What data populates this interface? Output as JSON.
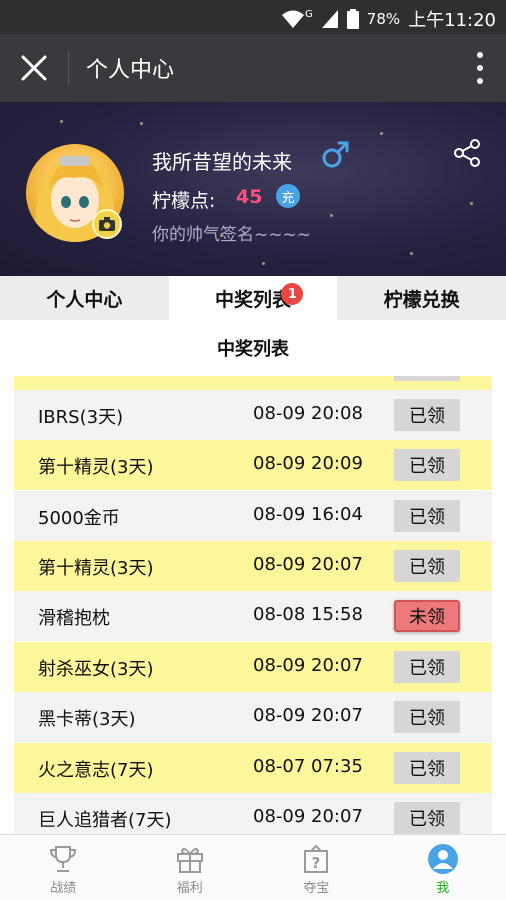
{
  "status_bar": {
    "battery": "78%",
    "time": "上午11:20",
    "network": "G"
  },
  "app_bar": {
    "title": "个人中心"
  },
  "profile": {
    "username": "我所昔望的未来",
    "points_label": "柠檬点:",
    "points_value": "45",
    "charge_label": "充",
    "signature": "你的帅气签名~~~~"
  },
  "tabs": [
    {
      "label": "个人中心"
    },
    {
      "label": "中奖列表",
      "badge": "1"
    },
    {
      "label": "柠檬兑换"
    }
  ],
  "list": {
    "title": "中奖列表",
    "rows": [
      {
        "name": "IBRS(3天)",
        "date": "08-09 20:08",
        "status": "已领"
      },
      {
        "name": "第十精灵(3天)",
        "date": "08-09 20:09",
        "status": "已领"
      },
      {
        "name": "5000金币",
        "date": "08-09 16:04",
        "status": "已领"
      },
      {
        "name": "第十精灵(3天)",
        "date": "08-09 20:07",
        "status": "已领"
      },
      {
        "name": "滑稽抱枕",
        "date": "08-08 15:58",
        "status": "未领"
      },
      {
        "name": "射杀巫女(3天)",
        "date": "08-09 20:07",
        "status": "已领"
      },
      {
        "name": "黑卡蒂(3天)",
        "date": "08-09 20:07",
        "status": "已领"
      },
      {
        "name": "火之意志(7天)",
        "date": "08-07 07:35",
        "status": "已领"
      },
      {
        "name": "巨人追猎者(7天)",
        "date": "08-09 20:07",
        "status": "已领"
      }
    ]
  },
  "bottom_nav": [
    {
      "label": "战绩",
      "icon": "trophy-icon"
    },
    {
      "label": "福利",
      "icon": "gift-icon"
    },
    {
      "label": "夺宝",
      "icon": "mystery-box-icon"
    },
    {
      "label": "我",
      "icon": "user-icon"
    }
  ],
  "colors": {
    "row_yellow": "#fef69a",
    "row_gray": "#f3f3f3",
    "points": "#ff4f7a",
    "active_nav": "#1aad19",
    "unclaimed": "#ec7a7a"
  }
}
